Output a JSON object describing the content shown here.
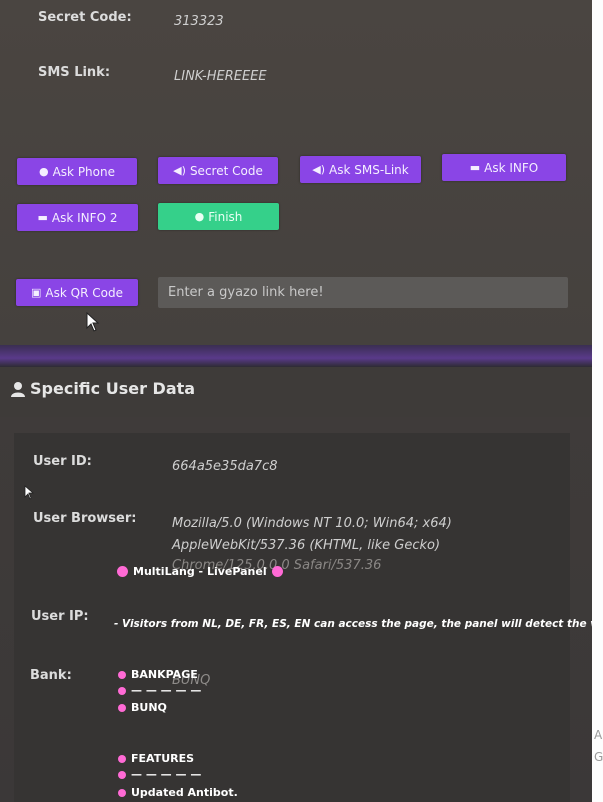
{
  "codes": {
    "secret_label": "Secret Code:",
    "secret_value": "313323",
    "sms_label": "SMS Link:",
    "sms_value": "LINK-HEREEEE"
  },
  "buttons": {
    "ask_phone": "Ask Phone",
    "secret_code": "Secret Code",
    "ask_sms_link": "Ask SMS-Link",
    "ask_info": "Ask INFO",
    "ask_info_2": "Ask INFO 2",
    "finish": "Finish",
    "ask_qr": "Ask QR Code"
  },
  "gyazo": {
    "placeholder": "Enter a gyazo link here!"
  },
  "section": {
    "title": "Specific User Data"
  },
  "user": {
    "id_label": "User ID:",
    "id_value": "664a5e35da7c8",
    "browser_label": "User Browser:",
    "browser_line1": "Mozilla/5.0 (Windows NT 10.0; Win64; x64)",
    "browser_line2": "AppleWebKit/537.36 (KHTML, like Gecko)",
    "browser_line3": "Chrome/125.0.0.0 Safari/537.36",
    "ip_label": "User IP:",
    "bank_label": "Bank:",
    "bank_value": "BUNQ"
  },
  "overlay": {
    "title": "MultiLang - LivePanel",
    "visitors_note": "- Visitors from NL, DE, FR, ES, EN can access the page, the panel will detect the visitor's brows",
    "bankpage": "BANKPAGE",
    "dashes1": "— — — — —",
    "bunq": "BUNQ",
    "features": "FEATURES",
    "dashes2": "— — — — —",
    "antibot": "Updated Antibot."
  },
  "edge": {
    "a": "A",
    "g": "G"
  },
  "colors": {
    "button_purple": "#8a45e6",
    "button_green": "#35d08a",
    "bullet_pink": "#ff6ad5"
  }
}
